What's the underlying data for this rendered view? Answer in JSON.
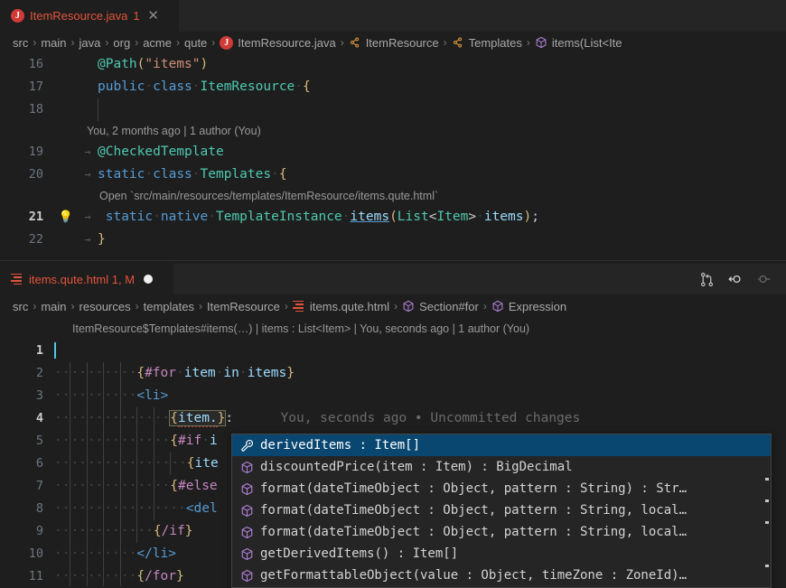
{
  "editor1": {
    "tab": {
      "icon": "java-file-icon",
      "label": "ItemResource.java",
      "problem_count": "1",
      "close_glyph": "✕"
    },
    "breadcrumbs": [
      {
        "label": "src",
        "icon": ""
      },
      {
        "label": "main",
        "icon": ""
      },
      {
        "label": "java",
        "icon": ""
      },
      {
        "label": "org",
        "icon": ""
      },
      {
        "label": "acme",
        "icon": ""
      },
      {
        "label": "qute",
        "icon": ""
      },
      {
        "label": "ItemResource.java",
        "icon": "java-file-icon"
      },
      {
        "label": "ItemResource",
        "icon": "class-icon"
      },
      {
        "label": "Templates",
        "icon": "class-icon"
      },
      {
        "label": "items(List<Ite",
        "icon": "method-icon"
      }
    ],
    "separator": "›",
    "lines": [
      {
        "no": "16"
      },
      {
        "no": "17"
      },
      {
        "no": "18"
      },
      {
        "no": "19"
      },
      {
        "no": "20"
      },
      {
        "no": "21"
      },
      {
        "no": "22"
      }
    ],
    "codelens1": "You, 2 months ago | 1 author (You)",
    "codelens2": "Open `src/main/resources/templates/ItemResource/items.qute.html`",
    "lightbulb": "💡"
  },
  "editor2": {
    "tab": {
      "icon": "template-file-icon",
      "label": "items.qute.html 1, M",
      "dirty_dot": true
    },
    "actions": [
      {
        "name": "compare-changes-icon"
      },
      {
        "name": "go-back-icon"
      },
      {
        "name": "go-forward-icon"
      }
    ],
    "breadcrumbs": [
      {
        "label": "src",
        "icon": ""
      },
      {
        "label": "main",
        "icon": ""
      },
      {
        "label": "resources",
        "icon": ""
      },
      {
        "label": "templates",
        "icon": ""
      },
      {
        "label": "ItemResource",
        "icon": ""
      },
      {
        "label": "items.qute.html",
        "icon": "template-file-icon"
      },
      {
        "label": "Section#for",
        "icon": "method-icon"
      },
      {
        "label": "Expression",
        "icon": "method-icon"
      }
    ],
    "separator": "›",
    "codelens": "ItemResource$Templates#items(…) | items : List<Item> | You, seconds ago | 1 author (You)",
    "inline_blame": "You, seconds ago • Uncommitted changes",
    "lines": [
      {
        "no": "1"
      },
      {
        "no": "2"
      },
      {
        "no": "3"
      },
      {
        "no": "4"
      },
      {
        "no": "5"
      },
      {
        "no": "6"
      },
      {
        "no": "7"
      },
      {
        "no": "8"
      },
      {
        "no": "9"
      },
      {
        "no": "10"
      },
      {
        "no": "11"
      }
    ]
  },
  "suggest": {
    "items": [
      {
        "icon": "property-icon",
        "label": "derivedItems : Item[]",
        "selected": true
      },
      {
        "icon": "method-icon",
        "label": "discountedPrice(item : Item) : BigDecimal",
        "selected": false
      },
      {
        "icon": "method-icon",
        "label": "format(dateTimeObject : Object, pattern : String) : Str…",
        "selected": false
      },
      {
        "icon": "method-icon",
        "label": "format(dateTimeObject : Object, pattern : String, local…",
        "selected": false
      },
      {
        "icon": "method-icon",
        "label": "format(dateTimeObject : Object, pattern : String, local…",
        "selected": false
      },
      {
        "icon": "method-icon",
        "label": "getDerivedItems() : Item[]",
        "selected": false
      },
      {
        "icon": "method-icon",
        "label": "getFormattableObject(value : Object, timeZone : ZoneId)…",
        "selected": false
      }
    ]
  },
  "colors": {
    "editor_background": "#1e1e1e",
    "tabbar_background": "#252526",
    "selected_suggestion": "#094771",
    "dirty_tab_text": "#e2543a",
    "keyword": "#569cd6",
    "type": "#4ec9b0",
    "string": "#ce9178",
    "section": "#c586c0",
    "variable": "#9cdcfe",
    "brace": "#d7ba7d"
  }
}
